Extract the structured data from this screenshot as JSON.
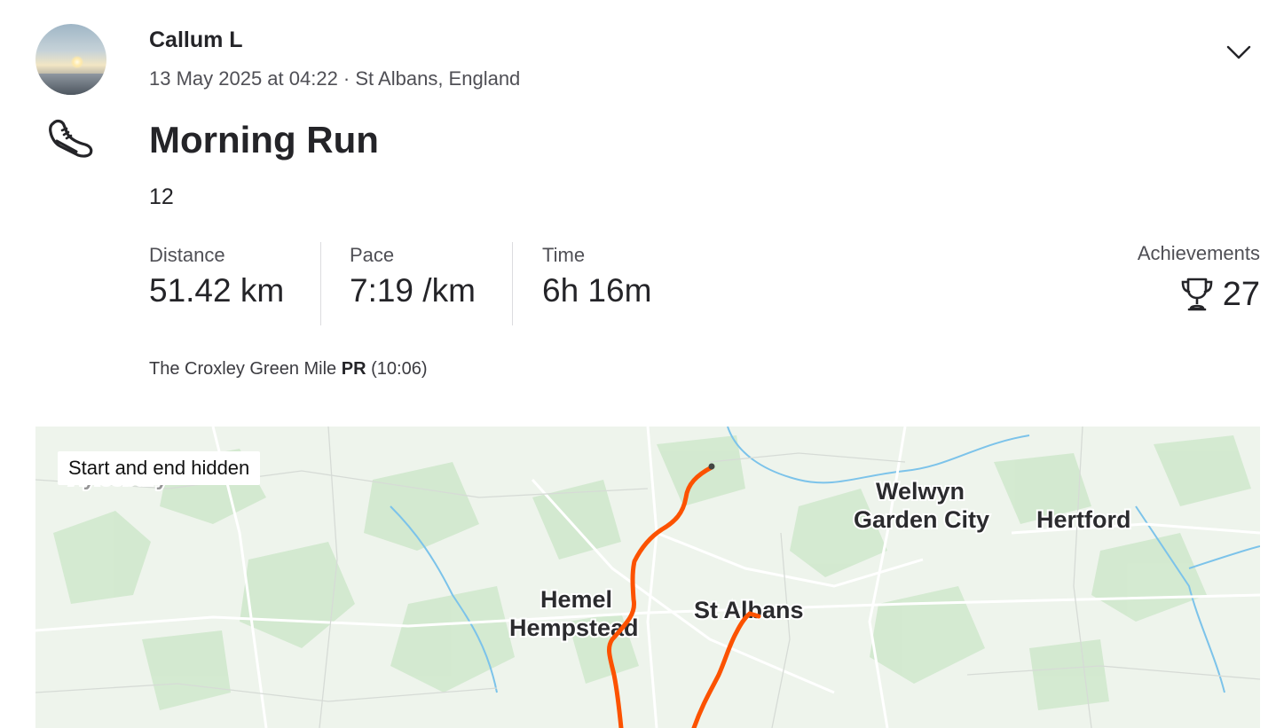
{
  "athlete": {
    "name": "Callum L",
    "meta": "13 May 2025 at 04:22 · St Albans, England",
    "avatar_icon": "avatar-sunset-photo"
  },
  "activity": {
    "type_icon": "running-shoe-icon",
    "title": "Morning Run",
    "description": "12"
  },
  "stats": [
    {
      "label": "Distance",
      "value": "51.42 km"
    },
    {
      "label": "Pace",
      "value": "7:19 /km"
    },
    {
      "label": "Time",
      "value": "6h 16m"
    }
  ],
  "achievements": {
    "label": "Achievements",
    "count": "27",
    "icon": "trophy-icon"
  },
  "segment_pr": {
    "segment": "The Croxley Green Mile",
    "badge": "PR",
    "time": "(10:06)"
  },
  "map": {
    "privacy_badge": "Start and end hidden",
    "places": [
      "Welwyn",
      "Garden City",
      "Hertford",
      "Hemel",
      "Hempstead",
      "St Albans",
      "Aylesbury"
    ],
    "route_color": "#fc5200"
  },
  "colors": {
    "text": "#242428",
    "muted": "#4f4f55",
    "route": "#fc5200",
    "map_bg": "#eef4ec"
  }
}
